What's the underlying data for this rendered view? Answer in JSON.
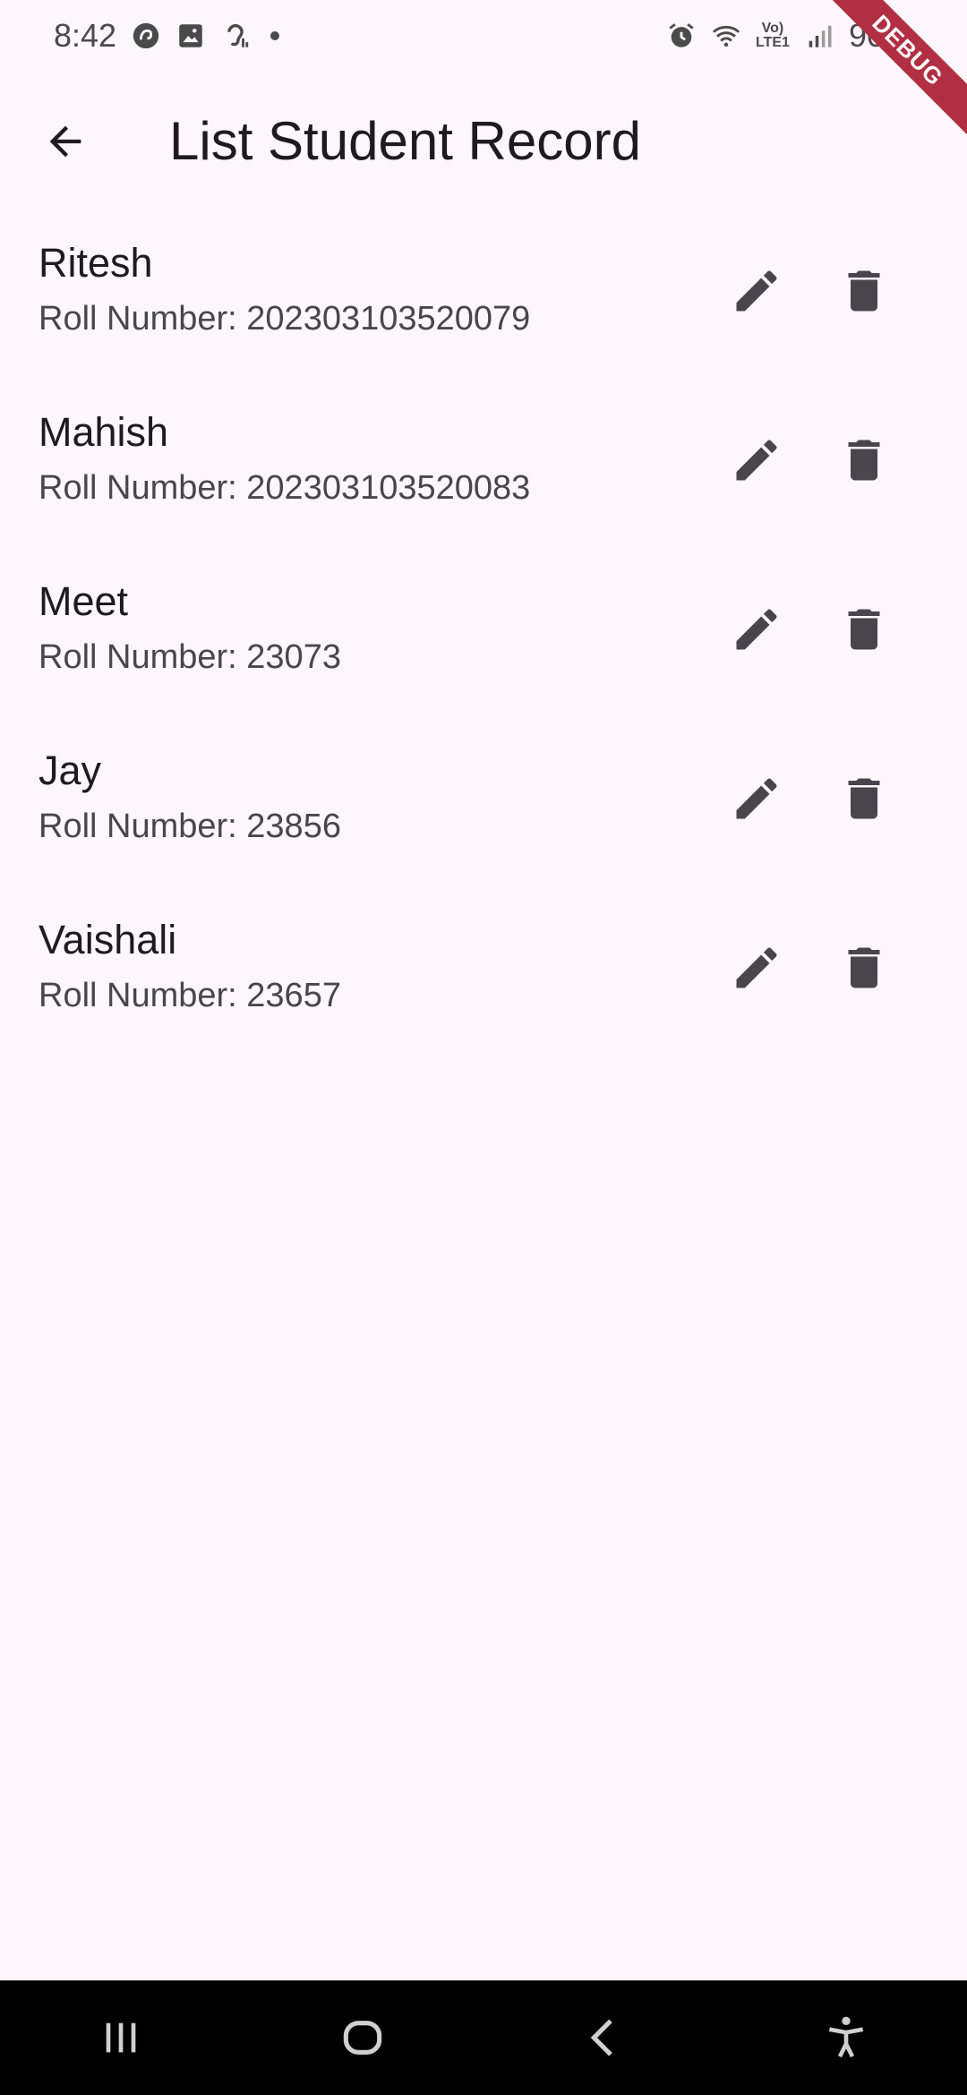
{
  "status_bar": {
    "time": "8:42",
    "battery": "90%",
    "lte_top": "Vo)",
    "lte_bottom": "LTE1",
    "icons": [
      "sync-icon",
      "image-icon",
      "hearing-icon",
      "alarm-icon",
      "wifi-icon",
      "signal-icon",
      "battery-icon"
    ]
  },
  "debug_banner": "DEBUG",
  "app_bar": {
    "title": "List Student Record",
    "back_icon": "arrow-back-icon"
  },
  "students": [
    {
      "name": "Ritesh",
      "roll": "Roll Number: 202303103520079"
    },
    {
      "name": "Mahish",
      "roll": "Roll Number: 202303103520083"
    },
    {
      "name": "Meet",
      "roll": "Roll Number: 23073"
    },
    {
      "name": "Jay",
      "roll": "Roll Number: 23856"
    },
    {
      "name": "Vaishali",
      "roll": "Roll Number: 23657"
    }
  ],
  "item_actions": [
    "edit-icon",
    "delete-icon"
  ],
  "nav_bar": [
    "recents-button",
    "home-button",
    "back-button",
    "accessibility-button"
  ],
  "colors": {
    "background": "#fdf7fd",
    "text_primary": "#1d1b20",
    "text_secondary": "#49454f",
    "icon": "#49454f",
    "debug_ribbon": "#b22f43"
  }
}
